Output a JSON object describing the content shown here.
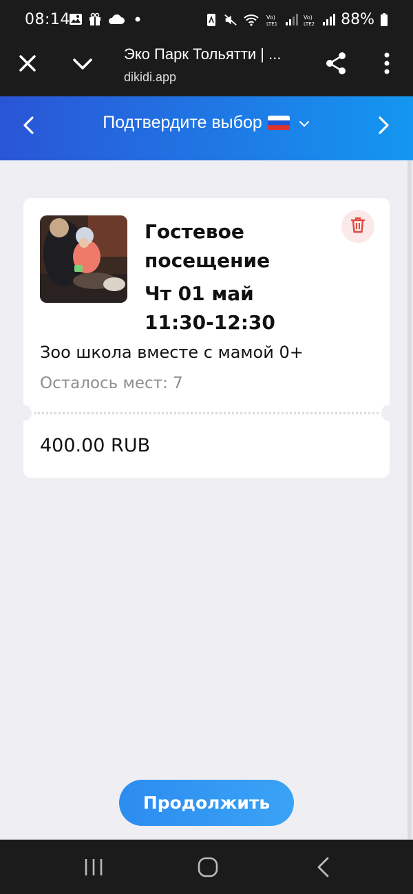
{
  "status_bar": {
    "time": "08:14",
    "battery": "88%",
    "left_icons": [
      "image-icon",
      "gift-icon",
      "cloud-icon",
      "dot-icon"
    ],
    "right_icons": [
      "nfc-icon",
      "mute-icon",
      "wifi-icon",
      "signal-lte1-icon",
      "signal-lte2-icon",
      "battery-icon"
    ]
  },
  "browser": {
    "title": "Эко Парк Тольятти | ...",
    "url": "dikidi.app"
  },
  "header": {
    "title": "Подтвердите выбор",
    "flag_colors": [
      "#ffffff",
      "#1c57d6",
      "#e0322c"
    ]
  },
  "booking": {
    "service_title": "Гостевое посещение",
    "date": "Чт 01 май",
    "time_range": "11:30-12:30",
    "description": "Зоо школа вместе с мамой 0+",
    "remaining": "Осталось мест: 7",
    "price": "400.00 RUB"
  },
  "actions": {
    "continue_label": "Продолжить"
  },
  "colors": {
    "header_gradient_start": "#2a55d6",
    "header_gradient_end": "#1497f0",
    "button": "#2f95f2",
    "delete_icon": "#e0483f",
    "background": "#eeeef3"
  }
}
